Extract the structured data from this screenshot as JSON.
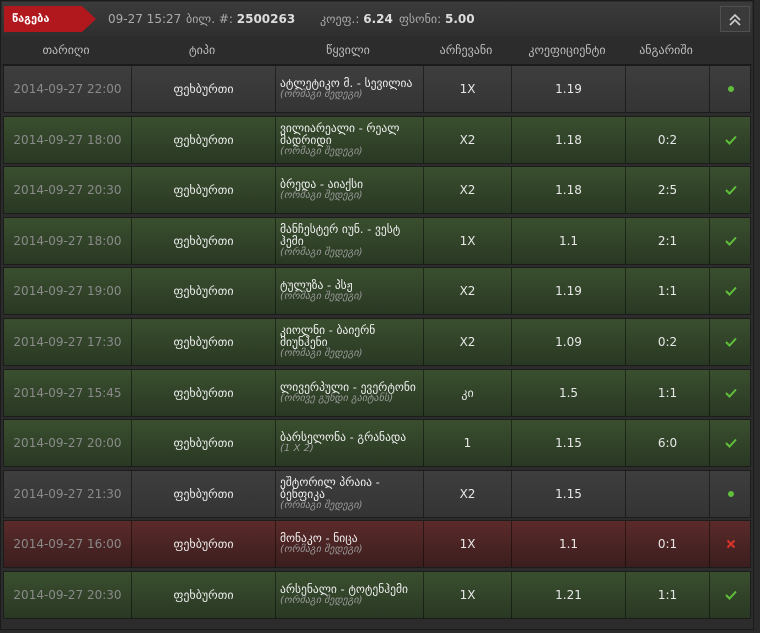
{
  "topbar": {
    "status_label": "წაგება",
    "datetime": "09-27 15:27",
    "ticket_label": "ბილ. #:",
    "ticket_number": "2500263",
    "coef_label": "კოეფ.:",
    "coef_value": "6.24",
    "stake_label": "ფსონი:",
    "stake_value": "5.00"
  },
  "columns": [
    "თარიღი",
    "ტიპი",
    "წყვილი",
    "არჩევანი",
    "კოეფიციენტი",
    "ანგარიში"
  ],
  "rows": [
    {
      "date": "2014-09-27 22:00",
      "sport": "ფეხბურთი",
      "event": "ატლეტიკო მ. - სევილია",
      "bet_type": "(ორმაგი შედეგი)",
      "outcome": "1X",
      "odds": "1.19",
      "score": "",
      "status": "pending"
    },
    {
      "date": "2014-09-27 18:00",
      "sport": "ფეხბურთი",
      "event": "ვილიარეალი - რეალ მადრიდი",
      "bet_type": "(ორმაგი შედეგი)",
      "outcome": "X2",
      "odds": "1.18",
      "score": "0:2",
      "status": "won"
    },
    {
      "date": "2014-09-27 20:30",
      "sport": "ფეხბურთი",
      "event": "ბრედა - აიაქსი",
      "bet_type": "(ორმაგი შედეგი)",
      "outcome": "X2",
      "odds": "1.18",
      "score": "2:5",
      "status": "won"
    },
    {
      "date": "2014-09-27 18:00",
      "sport": "ფეხბურთი",
      "event": "მანჩესტერ იუნ. - ვესტ ჰემი",
      "bet_type": "(ორმაგი შედეგი)",
      "outcome": "1X",
      "odds": "1.1",
      "score": "2:1",
      "status": "won"
    },
    {
      "date": "2014-09-27 19:00",
      "sport": "ფეხბურთი",
      "event": "ტულუზა - პსჟ",
      "bet_type": "(ორმაგი შედეგი)",
      "outcome": "X2",
      "odds": "1.19",
      "score": "1:1",
      "status": "won"
    },
    {
      "date": "2014-09-27 17:30",
      "sport": "ფეხბურთი",
      "event": "კიოლნი - ბაიერნ მიუნჰენი",
      "bet_type": "(ორმაგი შედეგი)",
      "outcome": "X2",
      "odds": "1.09",
      "score": "0:2",
      "status": "won"
    },
    {
      "date": "2014-09-27 15:45",
      "sport": "ფეხბურთი",
      "event": "ლივერპული - ევერტონი",
      "bet_type": "(ორივე გუნდი გაიტანს)",
      "outcome": "კი",
      "odds": "1.5",
      "score": "1:1",
      "status": "won"
    },
    {
      "date": "2014-09-27 20:00",
      "sport": "ფეხბურთი",
      "event": "ბარსელონა - გრანადა",
      "bet_type": "(1 X 2)",
      "outcome": "1",
      "odds": "1.15",
      "score": "6:0",
      "status": "won"
    },
    {
      "date": "2014-09-27 21:30",
      "sport": "ფეხბურთი",
      "event": "ეშტორილ პრაია - ბენფიკა",
      "bet_type": "(ორმაგი შედეგი)",
      "outcome": "X2",
      "odds": "1.15",
      "score": "",
      "status": "pending"
    },
    {
      "date": "2014-09-27 16:00",
      "sport": "ფეხბურთი",
      "event": "მონაკო - ნიცა",
      "bet_type": "(ორმაგი შედეგი)",
      "outcome": "1X",
      "odds": "1.1",
      "score": "0:1",
      "status": "lost"
    },
    {
      "date": "2014-09-27 20:30",
      "sport": "ფეხბურთი",
      "event": "არსენალი - ტოტენჰემი",
      "bet_type": "(ორმაგი შედეგი)",
      "outcome": "1X",
      "odds": "1.21",
      "score": "1:1",
      "status": "won"
    }
  ],
  "colors": {
    "won": "#5fbf3a",
    "lost": "#d9342c",
    "pending": "#5fbf3a",
    "accent": "#b1181d"
  },
  "icons": {
    "won": "check-icon",
    "lost": "cross-icon",
    "pending": "dot-icon",
    "collapse": "chevron-up-icon"
  }
}
